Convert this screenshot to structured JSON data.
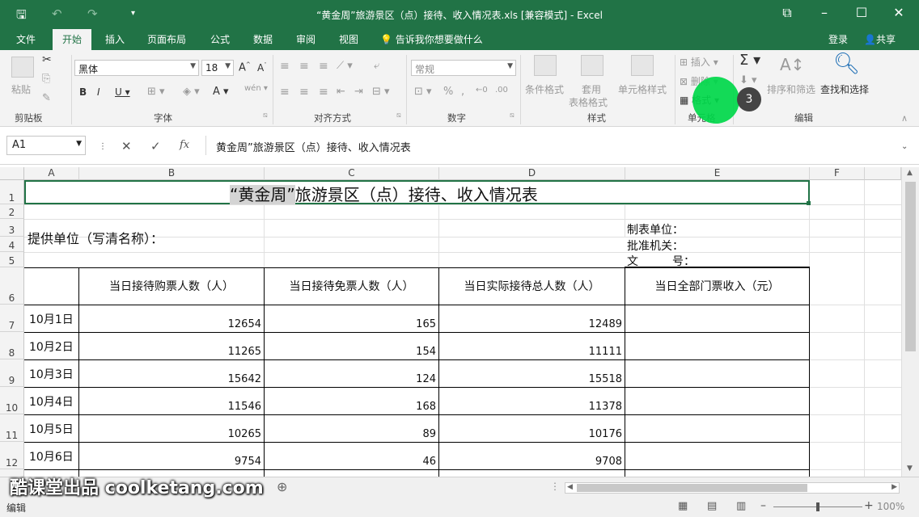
{
  "window": {
    "title": "“黄金周”旅游景区（点）接待、收入情况表.xls  [兼容模式] - Excel"
  },
  "tabs": [
    "文件",
    "开始",
    "插入",
    "页面布局",
    "公式",
    "数据",
    "审阅",
    "视图"
  ],
  "active_tab": "开始",
  "tell_me": "告诉我你想要做什么",
  "login": "登录",
  "share": "共享",
  "ribbon": {
    "clipboard": {
      "label": "剪贴板",
      "paste": "粘贴"
    },
    "font": {
      "label": "字体",
      "name": "黑体",
      "size": "18"
    },
    "alignment": {
      "label": "对齐方式"
    },
    "number": {
      "label": "数字",
      "format": "常规"
    },
    "styles": {
      "label": "样式",
      "conditional": "条件格式",
      "table": "套用",
      "table2": "表格格式",
      "cell": "单元格样式"
    },
    "cells": {
      "label": "单元格",
      "insert": "插入",
      "delete": "删除",
      "format": "格式"
    },
    "editing": {
      "label": "编辑",
      "sort": "排序和筛选",
      "find": "查找和选择"
    },
    "badge": "3"
  },
  "formula_bar": {
    "name_box": "A1",
    "fx": "fx",
    "content": "黄金周”旅游景区（点）接待、收入情况表"
  },
  "columns": [
    "A",
    "B",
    "C",
    "D",
    "E",
    "F"
  ],
  "rows": [
    "1",
    "2",
    "3",
    "4",
    "5",
    "6",
    "7",
    "8",
    "9",
    "10",
    "11",
    "12"
  ],
  "sheet": {
    "title_hl": "“黄金周”",
    "title_rest": "旅游景区（点）接待、收入情况表",
    "provider": "提供单位（写清名称）：",
    "maker": "制表单位：",
    "approver": "批准机关：",
    "docno": "文　　　号：",
    "headers": [
      "当日接待购票人数（人）",
      "当日接待免票人数（人）",
      "当日实际接待总人数（人）",
      "当日全部门票收入（元）"
    ],
    "data": [
      {
        "date": "10月1日",
        "paid": "12654",
        "free": "165",
        "total": "12489"
      },
      {
        "date": "10月2日",
        "paid": "11265",
        "free": "154",
        "total": "11111"
      },
      {
        "date": "10月3日",
        "paid": "15642",
        "free": "124",
        "total": "15518"
      },
      {
        "date": "10月4日",
        "paid": "11546",
        "free": "168",
        "total": "11378"
      },
      {
        "date": "10月5日",
        "paid": "10265",
        "free": "89",
        "total": "10176"
      },
      {
        "date": "10月6日",
        "paid": "9754",
        "free": "46",
        "total": "9708"
      }
    ]
  },
  "status": {
    "mode": "编辑",
    "zoom": "100%"
  },
  "watermark": "酷课堂出品 coolketang.com",
  "colors": {
    "excel_green": "#217346",
    "highlight": "#00d84a"
  }
}
